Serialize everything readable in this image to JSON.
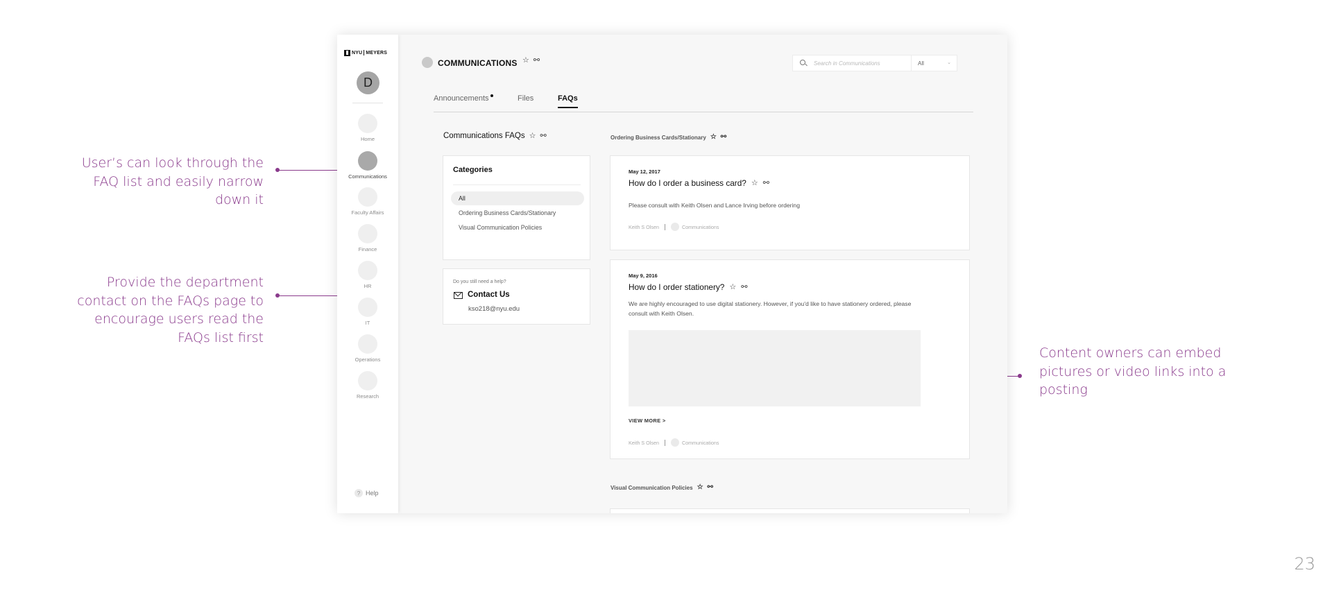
{
  "annotations": {
    "faq_list": [
      "User’s can look through the",
      "FAQ list and easily narrow",
      "down it"
    ],
    "contact": [
      "Provide the department",
      "contact on the FAQs page to",
      "encourage users read the",
      "FAQs list first"
    ],
    "embed": [
      "Content owners can embed",
      "pictures or video links into a",
      "posting"
    ]
  },
  "page_number": "23",
  "colors": {
    "annotation": "#8a3a8c",
    "active_nav": "#a9a9a9",
    "app_bg": "#f7f7f7"
  },
  "sidebar": {
    "logo": {
      "left": "NYU",
      "right": "MEYERS"
    },
    "avatar_initial": "D",
    "items": [
      {
        "label": "Home",
        "icon": "home-icon",
        "active": false
      },
      {
        "label": "Communications",
        "icon": "communications-icon",
        "active": true
      },
      {
        "label": "Faculty Affairs",
        "icon": "faculty-affairs-icon",
        "active": false
      },
      {
        "label": "Finance",
        "icon": "finance-icon",
        "active": false
      },
      {
        "label": "HR",
        "icon": "hr-icon",
        "active": false
      },
      {
        "label": "IT",
        "icon": "it-icon",
        "active": false
      },
      {
        "label": "Operations",
        "icon": "operations-icon",
        "active": false
      },
      {
        "label": "Research",
        "icon": "research-icon",
        "active": false
      }
    ],
    "help": "Help"
  },
  "header": {
    "title": "COMMUNICATIONS",
    "search_placeholder": "Search in Communications",
    "search_scope": "All"
  },
  "tabs": [
    {
      "label": "Announcements",
      "has_dot": true,
      "active": false
    },
    {
      "label": "Files",
      "has_dot": false,
      "active": false
    },
    {
      "label": "FAQs",
      "has_dot": false,
      "active": true
    }
  ],
  "faq_panel": {
    "title": "Communications FAQs",
    "categories_title": "Categories",
    "categories": [
      "All",
      "Ordering Business Cards/Stationary",
      "Visual Communication Policies"
    ],
    "selected_category": "All"
  },
  "contact": {
    "pre": "Do you still need a help?",
    "title": "Contact Us",
    "email": "kso218@nyu.edu"
  },
  "sections": [
    {
      "title": "Ordering Business Cards/Stationary",
      "faqs": [
        {
          "date": "May 12, 2017",
          "question": "How do I order a business card?",
          "body": "Please consult with Keith Olsen and Lance Irving before ordering",
          "author": "Keith S Olsen",
          "channel": "Communications"
        },
        {
          "date": "May 9, 2016",
          "question": "How do I order stationery?",
          "body": "We are highly encouraged to use digital stationery. However, if you'd like to have stationery ordered, please consult with Keith Olsen.",
          "view_more": "VIEW MORE >",
          "author": "Keith S Olsen",
          "channel": "Communications"
        }
      ]
    },
    {
      "title": "Visual Communication Policies",
      "faqs": []
    }
  ]
}
